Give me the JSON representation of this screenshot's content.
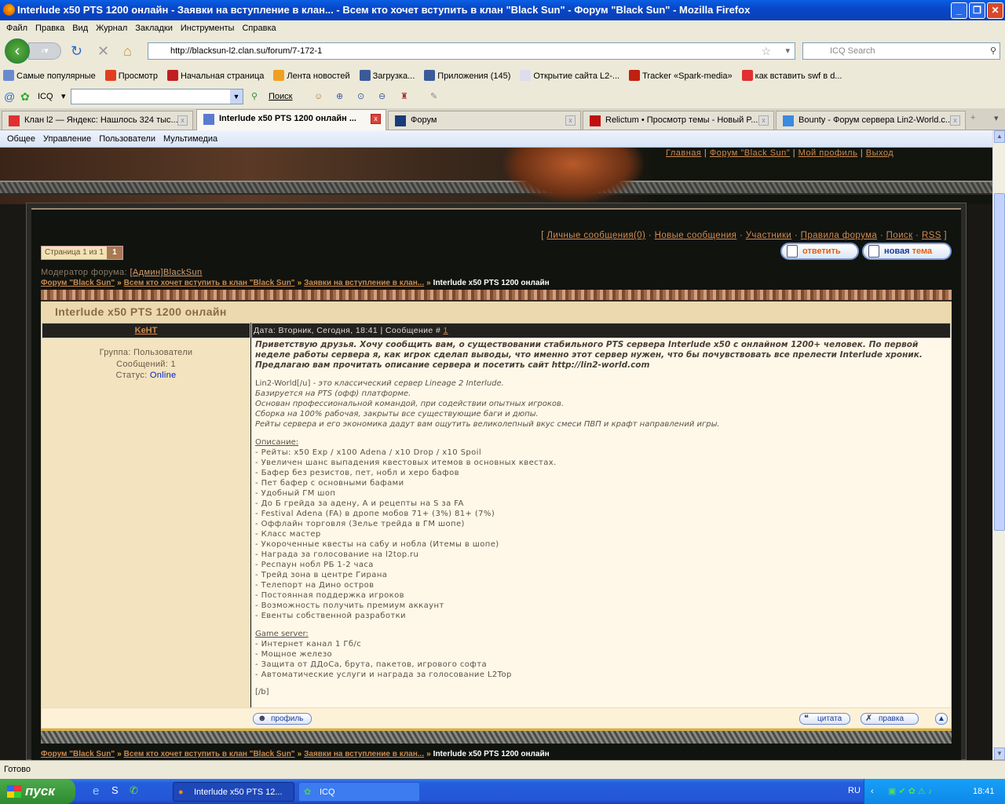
{
  "window": {
    "title": "Interlude x50 PTS 1200 онлайн - Заявки на вступление в клан... - Всем кто хочет вступить в клан \"Black Sun\" - Форум \"Black Sun\" - Mozilla Firefox"
  },
  "menu": [
    "Файл",
    "Правка",
    "Вид",
    "Журнал",
    "Закладки",
    "Инструменты",
    "Справка"
  ],
  "nav": {
    "url": "http://blacksun-l2.clan.su/forum/7-172-1",
    "search_placeholder": "ICQ Search"
  },
  "bookmarks": [
    {
      "label": "Самые популярные",
      "color": "#6a8ad0"
    },
    {
      "label": "Просмотр",
      "color": "#e04020"
    },
    {
      "label": "Начальная страница",
      "color": "#c02020"
    },
    {
      "label": "Лента новостей",
      "color": "#f0a020"
    },
    {
      "label": "Загрузка...",
      "color": "#3a5a9a"
    },
    {
      "label": "Приложения (145)",
      "color": "#3a5a9a"
    },
    {
      "label": "Открытие сайта L2-...",
      "color": "#dde"
    },
    {
      "label": "Tracker «Spark-media»",
      "color": "#c02010"
    },
    {
      "label": "как вставить swf в d...",
      "color": "#e03030"
    }
  ],
  "icqbar": {
    "icq_label": "ICQ",
    "search_label": "Поиск"
  },
  "tabs": [
    {
      "label": "Клан l2 — Яндекс: Нашлось 324 тыс...",
      "active": false,
      "icon_color": "#e03030"
    },
    {
      "label": "Interlude x50 PTS 1200 онлайн ...",
      "active": true,
      "icon_color": "#5a7ad0"
    },
    {
      "label": "Форум",
      "active": false,
      "icon_color": "#1a3a7a"
    },
    {
      "label": "Relictum • Просмотр темы - Новый P...",
      "active": false,
      "icon_color": "#c01010"
    },
    {
      "label": "Bounty - Форум сервера Lin2-World.c...",
      "active": false,
      "icon_color": "#3a8ae0"
    }
  ],
  "ucoz_menu": [
    "Общее",
    "Управление",
    "Пользователи",
    "Мультимедиа"
  ],
  "site": {
    "top_links": [
      "Главная",
      "Форум \"Black Sun\"",
      "Мой профиль",
      "Выход"
    ],
    "forum_links": [
      "Личные сообщения(0)",
      "Новые сообщения",
      "Участники",
      "Правила форума",
      "Поиск",
      "RSS"
    ],
    "pager": {
      "label": "Страница 1 из 1",
      "current": "1"
    },
    "reply_button": "ответить",
    "new_topic_button": {
      "part1": "новая",
      "part2": "тема"
    },
    "moderator_label": "Модератор форума:",
    "moderator_name": "[Админ]BlackSun",
    "breadcrumbs": [
      "Форум \"Black Sun\"",
      "Всем кто хочет вступить в клан \"Black Sun\"",
      "Заявки на вступление в клан..."
    ],
    "breadcrumb_current": "Interlude x50 PTS 1200 онлайн",
    "crumb_sep": "»",
    "topic_title": "Interlude x50 PTS 1200 онлайн"
  },
  "post": {
    "author": "KeHT",
    "date_text": "Дата: Вторник, Сегодня, 18:41 | Сообщение #",
    "post_number": "1",
    "group": "Группа: Пользователи",
    "messages": "Сообщений: 1",
    "status_label": "Статус:",
    "status": "Online",
    "intro": "Приветствую друзья. Хочу сообщить вам, о существовании стабильного PTS сервера Interlude x50 с онлайном 1200+ человек. По первой неделе работы сервера я, как игрок сделап выводы, что именно этот сервер нужен, что бы почувствовать все прелести Interlude хроник. Предлагаю вам прочитать описание сервера и посетить сайт http://lin2-world.com",
    "desc_first": "Lin2-World[/u]",
    "desc_first_rest": " - это классический сервер Lineage 2 Interlude.",
    "desc": [
      "Базируется на PTS (офф) платформе.",
      "Основан профессиональной командой, при содействии опытных игроков.",
      "Сборка на 100% рабочая, закрыты все существующие баги и дюпы.",
      "Рейты сервера и его экономика дадут вам ощутить великолепный вкус смеси ПВП и крафт направлений игры."
    ],
    "features_title": "Описание:",
    "features": [
      "- Рейты: x50 Exp / x100 Adena / x10 Drop / x10 Spoil",
      "- Увеличен шанс выпадения квестовых итемов в основных квестах.",
      "- Бафер без резистов, пет, нобл и херо бафов",
      "- Пет бафер с основными бафами",
      "- Удобный ГМ шоп",
      "- До Б грейда за адену, А и рецепты на S за FA",
      "- Festival Adena (FA) в дропе мобов 71+ (3%) 81+ (7%)",
      "- Оффлайн торговля (Зелье трейда в ГМ шопе)",
      "- Класс мастер",
      "- Укороченные квесты на сабу и нобла (Итемы в шопе)",
      "- Награда за голосование на l2top.ru",
      "- Респаун нобл РБ 1-2 часа",
      "- Трейд зона в центре Гирана",
      "- Телепорт на Дино остров",
      "- Постоянная поддержка игроков",
      "- Возможность получить премиум аккаунт",
      "- Евенты собственной разработки"
    ],
    "server_title": "Game server:",
    "server": [
      "- Интернет канал 1 Гб/с",
      "- Мощное железо",
      "- Защита от ДДоСа, брута, пакетов, игрового софта",
      "- Автоматические услуги и награда за голосование L2Top"
    ],
    "closing": "[/b]",
    "profile_button": "профиль",
    "quote_button": "цитата",
    "edit_button": "правка"
  },
  "status_bar": "Готово",
  "taskbar": {
    "start": "пуск",
    "tasks": [
      "Interlude x50 PTS 12...",
      "ICQ"
    ],
    "lang": "RU",
    "time": "18:41"
  },
  "colors": {
    "link": "#d08a50",
    "post_bg": "#fff8e8",
    "title_bar": "#0a5fe4",
    "taskbar": "#245edc"
  }
}
